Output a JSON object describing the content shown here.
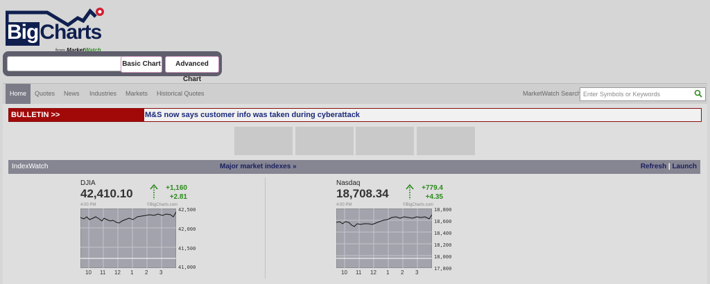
{
  "logo": {
    "big": "Big",
    "charts": "Charts",
    "from": "from",
    "brand_a": "Market",
    "brand_b": "Watch"
  },
  "toolbar": {
    "symbol_value": "",
    "basic_label": "Basic Chart",
    "advanced_label": "Advanced Chart"
  },
  "nav": {
    "items": [
      "Home",
      "Quotes",
      "News",
      "Industries",
      "Markets",
      "Historical Quotes"
    ],
    "search_label": "MarketWatch Search",
    "search_placeholder": "Enter Symbols or Keywords"
  },
  "bulletin": {
    "label": "BULLETIN >>",
    "text": "M&S now says customer info was taken during cyberattack"
  },
  "indexwatch": {
    "title": "IndexWatch",
    "major_link": "Major market indexes »",
    "refresh": "Refresh",
    "sep": "|",
    "launch": "Launch"
  },
  "indexes": [
    {
      "name": "DJIA",
      "value": "42,410.10",
      "change": "+1,160",
      "pct": "+2.81",
      "time": "4:00  PM",
      "source": "©BigCharts.com",
      "yticks": [
        "42,500",
        "42,000",
        "41,500",
        "41,000"
      ],
      "xticks": [
        "10",
        "11",
        "12",
        "1",
        "2",
        "3"
      ]
    },
    {
      "name": "Nasdaq",
      "value": "18,708.34",
      "change": "+779.4",
      "pct": "+4.35",
      "time": "4:00  PM",
      "source": "©BigCharts.com",
      "yticks": [
        "18,800",
        "18,600",
        "18,400",
        "18,200",
        "18,000",
        "17,800"
      ],
      "xticks": [
        "10",
        "11",
        "12",
        "1",
        "2",
        "3"
      ]
    }
  ],
  "colors": {
    "up": "#2a8a1a",
    "bulletin": "#a10808",
    "nav_active": "#7b7b88",
    "link": "#1b2060"
  }
}
